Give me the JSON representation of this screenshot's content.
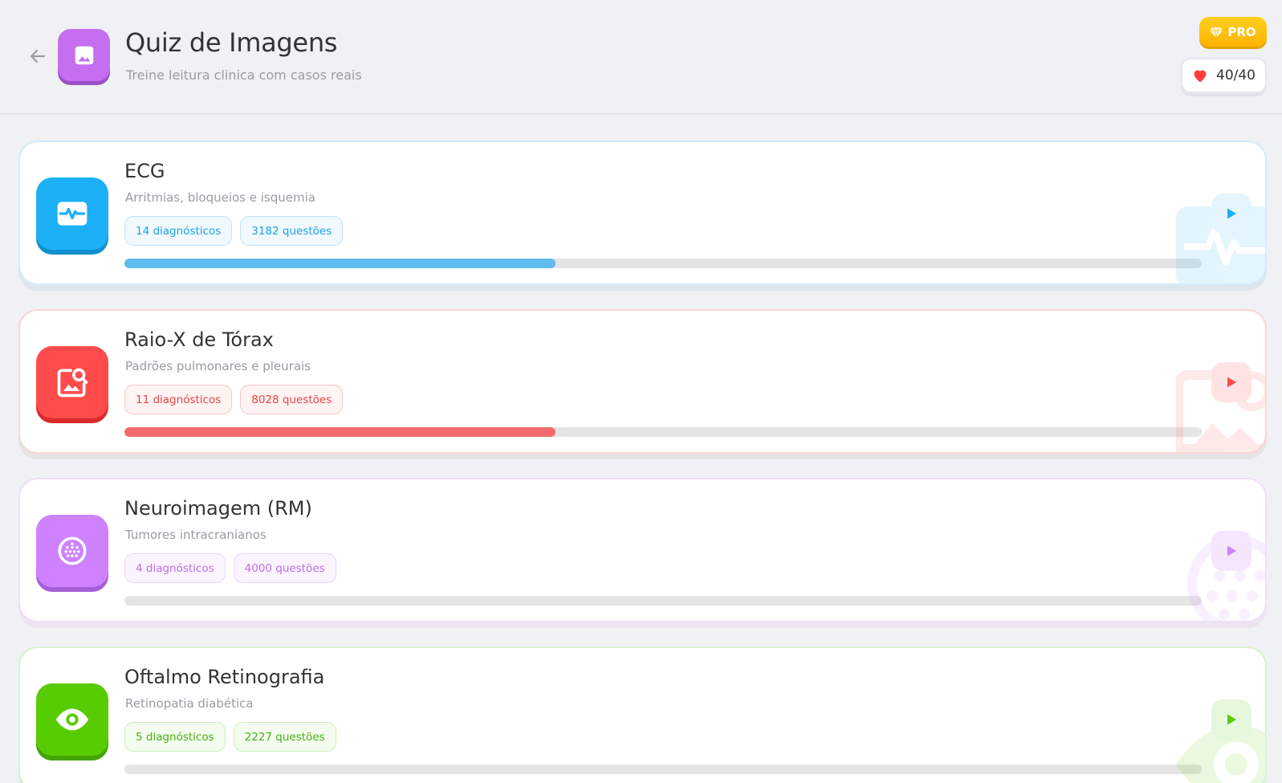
{
  "header": {
    "title": "Quiz de Imagens",
    "subtitle": "Treine leitura clinica com casos reais",
    "back_icon": "arrow-left-icon",
    "app_icon": "image-icon",
    "pro_label": "PRO",
    "lives": "40/40"
  },
  "colors": {
    "ecg": "#1cb0f6",
    "raio_x": "#ff4b4b",
    "neuro": "#ce82ff",
    "oftalmo": "#58cc02",
    "pro": "#ffc107"
  },
  "quizzes": [
    {
      "title": "ECG",
      "description": "Arritmias, bloqueios e isquemia",
      "diagnoses": "14 diagnósticos",
      "questions": "3182 questões",
      "progress": 0.4,
      "icon": "heart-pulse-icon"
    },
    {
      "title": "Raio-X de Tórax",
      "description": "Padrões pulmonares e pleurais",
      "diagnoses": "11 diagnósticos",
      "questions": "8028 questões",
      "progress": 0.4,
      "icon": "image-search-icon"
    },
    {
      "title": "Neuroimagem (RM)",
      "description": "Tumores intracranianos",
      "diagnoses": "4 diagnósticos",
      "questions": "4000 questões",
      "progress": 0,
      "icon": "brain-scan-icon"
    },
    {
      "title": "Oftalmo Retinografia",
      "description": "Retinopatia diabética",
      "diagnoses": "5 diagnósticos",
      "questions": "2227 questões",
      "progress": 0,
      "icon": "eye-icon"
    }
  ]
}
